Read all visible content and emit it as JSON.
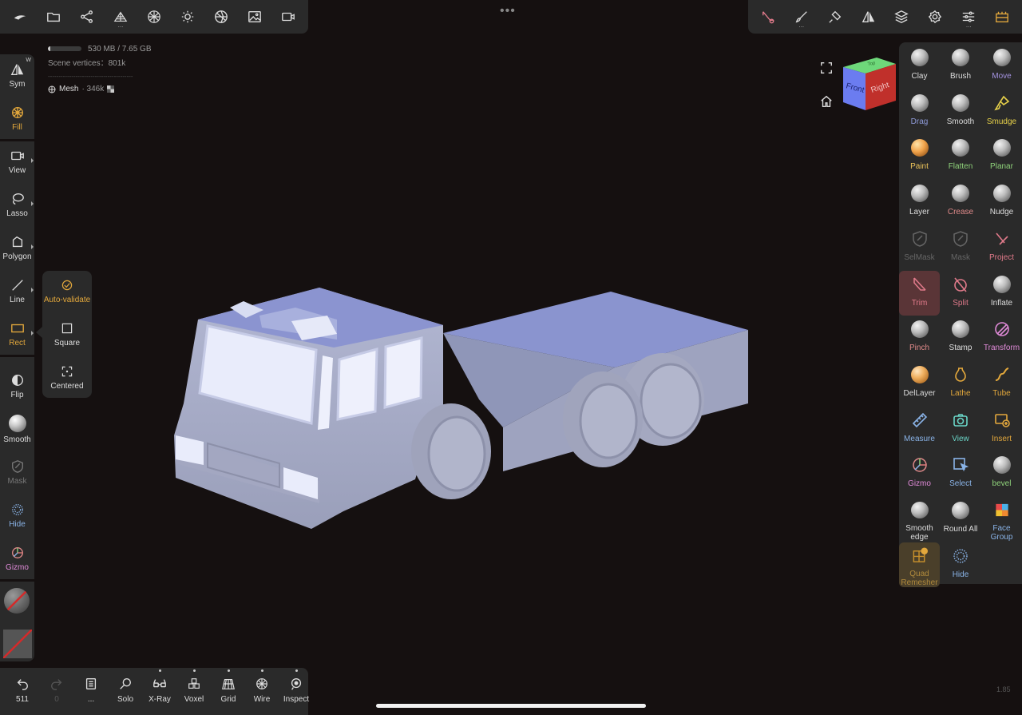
{
  "top_left_toolbar": {
    "icons": [
      "nomad-logo-icon",
      "folder-icon",
      "scene-graph-icon",
      "multires-icon",
      "topology-icon",
      "light-icon",
      "material-icon",
      "background-image-icon",
      "camera-icon"
    ]
  },
  "top_right_toolbar": {
    "icons": [
      "trim-tool-icon",
      "brush-settings-icon",
      "stroke-settings-icon",
      "symmetry-icon",
      "layers-icon",
      "settings-icon",
      "sliders-icon",
      "interface-icon"
    ]
  },
  "stats": {
    "memory": "530 MB / 7.65 GB",
    "memory_fraction": 0.07,
    "vertices": "Scene vertices：801k",
    "separator": "----------------------------------------",
    "mesh_name": "Mesh",
    "mesh_vertices": "· 346k"
  },
  "left_toolbar": {
    "sym": {
      "label": "Sym",
      "badge": "W"
    },
    "fill": "Fill",
    "view": "View",
    "lasso": "Lasso",
    "polygon": "Polygon",
    "line": "Line",
    "rect": "Rect",
    "flip": "Flip",
    "smooth": "Smooth",
    "mask": "Mask",
    "hide": "Hide",
    "gizmo": "Gizmo"
  },
  "rect_menu": {
    "auto_validate": "Auto-validate",
    "square": "Square",
    "centered": "Centered"
  },
  "view_cube": {
    "front": "Front",
    "right": "Right",
    "top": "Top"
  },
  "tools": [
    {
      "label": "Clay",
      "color": "#dddddd",
      "kind": "ball"
    },
    {
      "label": "Brush",
      "color": "#dddddd",
      "kind": "ball"
    },
    {
      "label": "Move",
      "color": "#a493e0",
      "kind": "ball"
    },
    {
      "label": "Drag",
      "color": "#8e9ad8",
      "kind": "ball"
    },
    {
      "label": "Smooth",
      "color": "#dddddd",
      "kind": "ball"
    },
    {
      "label": "Smudge",
      "color": "#e8d24a",
      "kind": "smudge"
    },
    {
      "label": "Paint",
      "color": "#ebc35a",
      "kind": "paint"
    },
    {
      "label": "Flatten",
      "color": "#8fd27a",
      "kind": "ball"
    },
    {
      "label": "Planar",
      "color": "#8fd27a",
      "kind": "ball"
    },
    {
      "label": "Layer",
      "color": "#dddddd",
      "kind": "ball"
    },
    {
      "label": "Crease",
      "color": "#e08a8a",
      "kind": "ball"
    },
    {
      "label": "Nudge",
      "color": "#dddddd",
      "kind": "ball"
    },
    {
      "label": "SelMask",
      "color": "#666666",
      "kind": "shield"
    },
    {
      "label": "Mask",
      "color": "#666666",
      "kind": "shield"
    },
    {
      "label": "Project",
      "color": "#e07a8a",
      "kind": "project"
    },
    {
      "label": "Trim",
      "color": "#e07a8a",
      "kind": "trim"
    },
    {
      "label": "Split",
      "color": "#e07a8a",
      "kind": "split"
    },
    {
      "label": "Inflate",
      "color": "#dddddd",
      "kind": "ball"
    },
    {
      "label": "Pinch",
      "color": "#e08a8a",
      "kind": "ball"
    },
    {
      "label": "Stamp",
      "color": "#dddddd",
      "kind": "ball"
    },
    {
      "label": "Transform",
      "color": "#e08ad8",
      "kind": "transform"
    },
    {
      "label": "DelLayer",
      "color": "#dddddd",
      "kind": "dellayer"
    },
    {
      "label": "Lathe",
      "color": "#e3a83c",
      "kind": "lathe"
    },
    {
      "label": "Tube",
      "color": "#e3a83c",
      "kind": "tube"
    },
    {
      "label": "Measure",
      "color": "#8ab4e8",
      "kind": "measure"
    },
    {
      "label": "View",
      "color": "#6ad6c8",
      "kind": "camera"
    },
    {
      "label": "Insert",
      "color": "#e3a83c",
      "kind": "insert"
    },
    {
      "label": "Gizmo",
      "color": "#e08ad8",
      "kind": "gizmo"
    },
    {
      "label": "Select",
      "color": "#8ab4e8",
      "kind": "select"
    },
    {
      "label": "bevel",
      "color": "#8fd27a",
      "kind": "ball"
    },
    {
      "label": "Smooth edge",
      "color": "#dddddd",
      "kind": "ball"
    },
    {
      "label": "Round All",
      "color": "#dddddd",
      "kind": "ball"
    },
    {
      "label": "Face Group",
      "color": "#8ab4e8",
      "kind": "facegroup"
    },
    {
      "label": "Quad Remesher",
      "color": "#b08a3c",
      "kind": "quad"
    },
    {
      "label": "Hide",
      "color": "#8ab4e8",
      "kind": "hide"
    }
  ],
  "bottom_toolbar": {
    "undo_count": "511",
    "redo_count": "0",
    "history": "...",
    "solo": "Solo",
    "xray": "X-Ray",
    "voxel": "Voxel",
    "grid": "Grid",
    "wire": "Wire",
    "inspect": "Inspect"
  },
  "version": "1.85"
}
